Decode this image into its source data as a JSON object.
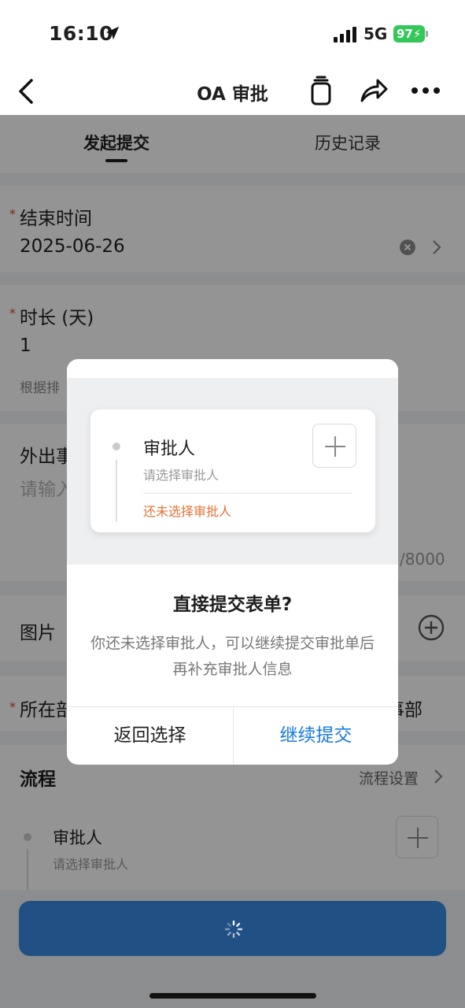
{
  "status_bar": {
    "time": "16:10",
    "network": "5G",
    "battery": "97"
  },
  "nav": {
    "title": "OA 审批"
  },
  "tabs": {
    "active": "发起提交",
    "inactive": "历史记录"
  },
  "form": {
    "end_time": {
      "label": "结束时间",
      "value": "2025-06-26",
      "required": true
    },
    "duration": {
      "label": "时长 (天)",
      "value": "1",
      "hint": "根据排",
      "required": true
    },
    "outing": {
      "label": "外出事",
      "placeholder": "请输入",
      "counter": "/8000"
    },
    "images": {
      "label": "图片"
    },
    "department": {
      "label": "所在部",
      "value": "事部",
      "required": true
    },
    "process": {
      "label": "流程",
      "settings": "流程设置"
    },
    "approver": {
      "title": "审批人",
      "subtitle": "请选择审批人"
    }
  },
  "dialog": {
    "illustration": {
      "title": "审批人",
      "subtitle": "请选择审批人",
      "warning": "还未选择审批人"
    },
    "title": "直接提交表单?",
    "message": "你还未选择审批人，可以继续提交审批单后再补充审批人信息",
    "cancel_label": "返回选择",
    "confirm_label": "继续提交"
  },
  "colors": {
    "primary": "#3a8ae6",
    "link": "#1a7ae0",
    "warning": "#e57336",
    "required": "#e8402f",
    "battery": "#34c759"
  }
}
